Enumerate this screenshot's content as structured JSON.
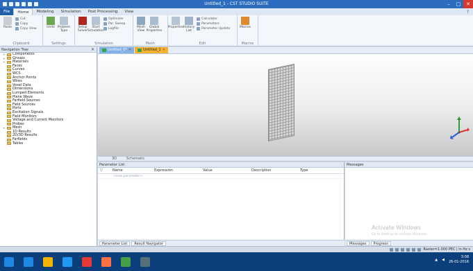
{
  "window": {
    "title": "Untitled_1 - CST STUDIO SUITE",
    "controls": {
      "minimize": "–",
      "maximize": "□",
      "close": "✕"
    }
  },
  "ribbon_tabs": [
    {
      "label": "File"
    },
    {
      "label": "Home"
    },
    {
      "label": "Modeling"
    },
    {
      "label": "Simulation"
    },
    {
      "label": "Post Processing"
    },
    {
      "label": "View"
    }
  ],
  "ribbon_groups": {
    "clipboard": {
      "label": "Clipboard",
      "paste": "Paste",
      "items": [
        "Cut",
        "Copy",
        "Copy View"
      ]
    },
    "settings": {
      "label": "Settings",
      "items": [
        {
          "label": "Units",
          "icon": "units-icon"
        },
        {
          "label": "Problem Type",
          "icon": "problem-type-icon"
        }
      ]
    },
    "simulation": {
      "label": "Simulation",
      "items": [
        {
          "label": "Setup Solver",
          "icon": "setup-solver-icon"
        },
        {
          "label": "Start Simulation",
          "icon": "start-simulation-icon"
        }
      ],
      "small": [
        "Optimizer",
        "Par. Sweep",
        "Logfile"
      ]
    },
    "mesh": {
      "label": "Mesh",
      "items": [
        {
          "label": "Mesh View",
          "icon": "mesh-view-icon"
        },
        {
          "label": "Global Properties",
          "icon": "global-properties-icon"
        }
      ]
    },
    "edit": {
      "label": "Edit",
      "items": [
        {
          "label": "Properties",
          "icon": "properties-icon"
        },
        {
          "label": "History List",
          "icon": "history-list-icon"
        }
      ],
      "small": [
        "Calculator",
        "Parameters",
        "Parameter Update"
      ]
    },
    "macros": {
      "label": "Macros",
      "items": [
        {
          "label": "Macros",
          "icon": "macros-icon"
        }
      ]
    }
  },
  "navigation_tree": {
    "title": "Navigation Tree",
    "items": [
      {
        "label": "Components",
        "expandable": true
      },
      {
        "label": "Groups",
        "expandable": true
      },
      {
        "label": "Materials",
        "expandable": true
      },
      {
        "label": "Faces",
        "expandable": false
      },
      {
        "label": "Curves",
        "expandable": false
      },
      {
        "label": "WCS",
        "expandable": false
      },
      {
        "label": "Anchor Points",
        "expandable": false
      },
      {
        "label": "Wires",
        "expandable": false
      },
      {
        "label": "Voxel Data",
        "expandable": false
      },
      {
        "label": "Dimensions",
        "expandable": false
      },
      {
        "label": "Lumped Elements",
        "expandable": false
      },
      {
        "label": "Plane Wave",
        "expandable": false
      },
      {
        "label": "Farfield Sources",
        "expandable": false
      },
      {
        "label": "Field Sources",
        "expandable": false
      },
      {
        "label": "Ports",
        "expandable": false
      },
      {
        "label": "Excitation Signals",
        "expandable": false
      },
      {
        "label": "Field Monitors",
        "expandable": false
      },
      {
        "label": "Voltage and Current Monitors",
        "expandable": false
      },
      {
        "label": "Probes",
        "expandable": false
      },
      {
        "label": "Mesh",
        "expandable": true
      },
      {
        "label": "1D Results",
        "expandable": false
      },
      {
        "label": "2D/3D Results",
        "expandable": false
      },
      {
        "label": "Farfields",
        "expandable": false
      },
      {
        "label": "Tables",
        "expandable": false
      }
    ]
  },
  "doc_tabs": [
    {
      "label": "Untitled_0*",
      "close": "✕"
    },
    {
      "label": "Untitled_1",
      "close": "✕"
    }
  ],
  "view_strip": {
    "items": [
      "3D",
      "Schematic"
    ]
  },
  "parameter_list": {
    "title": "Parameter List",
    "filter_icon": "filter-icon",
    "columns": [
      "Name",
      "Expression",
      "Value",
      "Description",
      "Type"
    ],
    "new_row_placeholder": "<new parameter>",
    "bottom_tabs": [
      "Parameter List",
      "Result Navigator"
    ]
  },
  "messages": {
    "title": "Messages",
    "bottom_tabs": [
      "Messages",
      "Progress"
    ],
    "watermark": "Activate Windows",
    "watermark_sub": "Go to Settings to activate Windows."
  },
  "status_bar": {
    "text": "Raster=1.000  PEC  | in  Hz  s"
  },
  "taskbar": {
    "apps": [
      {
        "name": "windows-start-icon",
        "color": "#1e88e5"
      },
      {
        "name": "task-view-icon",
        "color": "#1e88e5"
      },
      {
        "name": "file-explorer-icon",
        "color": "#f4b400"
      },
      {
        "name": "edge-icon",
        "color": "#2196f3"
      },
      {
        "name": "chrome-icon",
        "color": "#e53935"
      },
      {
        "name": "media-icon",
        "color": "#ff7043"
      },
      {
        "name": "cst-app-icon",
        "color": "#43a047"
      },
      {
        "name": "photos-icon",
        "color": "#546e7a"
      }
    ],
    "time": "3:08",
    "date": "26-01-2016"
  },
  "colors": {
    "titlebar": "#2b6cbf",
    "taskbar": "#0a3f7c",
    "doc_tab_one": "#7fb3e8",
    "doc_tab_two": "#f2b233"
  }
}
